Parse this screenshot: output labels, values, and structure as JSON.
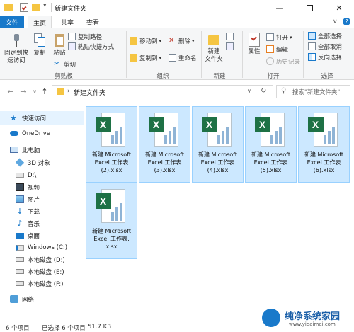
{
  "window": {
    "title": "新建文件夹"
  },
  "ribbon_tabs": [
    "文件",
    "主页",
    "共享",
    "查看"
  ],
  "ribbon": {
    "clipboard": {
      "pin_label_1": "固定到快",
      "pin_label_2": "速访问",
      "copy_label": "复制",
      "paste_label": "粘贴",
      "copy_path": "复制路径",
      "paste_shortcut": "粘贴快捷方式",
      "cut": "剪切",
      "group": "剪贴板"
    },
    "organize": {
      "move_to": "移动到",
      "delete": "删除",
      "copy_to": "复制到",
      "rename": "重命名",
      "group": "组织"
    },
    "new": {
      "new_folder_1": "新建",
      "new_folder_2": "文件夹",
      "group": "新建"
    },
    "open": {
      "properties": "属性",
      "open": "打开",
      "edit": "编辑",
      "history": "历史记录",
      "group": "打开"
    },
    "select": {
      "select_all": "全部选择",
      "select_none": "全部取消",
      "invert": "反向选择",
      "group": "选择"
    }
  },
  "address": {
    "path": "新建文件夹",
    "search_placeholder": "搜索\"新建文件夹\""
  },
  "nav": {
    "quick_access": "快速访问",
    "onedrive": "OneDrive",
    "this_pc": "此电脑",
    "objects3d": "3D 对象",
    "d_drive": "D:\\",
    "videos": "视频",
    "pictures": "图片",
    "downloads": "下载",
    "music": "音乐",
    "desktop": "桌面",
    "windows_c": "Windows (C:)",
    "disk_d": "本地磁盘 (D:)",
    "disk_e": "本地磁盘 (E:)",
    "disk_f": "本地磁盘 (F:)",
    "network": "网络"
  },
  "files": [
    {
      "l1": "新建 Microsoft",
      "l2": "Excel 工作表",
      "l3": "(2).xlsx"
    },
    {
      "l1": "新建 Microsoft",
      "l2": "Excel 工作表",
      "l3": "(3).xlsx"
    },
    {
      "l1": "新建 Microsoft",
      "l2": "Excel 工作表",
      "l3": "(4).xlsx"
    },
    {
      "l1": "新建 Microsoft",
      "l2": "Excel 工作表",
      "l3": "(5).xlsx"
    },
    {
      "l1": "新建 Microsoft",
      "l2": "Excel 工作表",
      "l3": "(6).xlsx"
    },
    {
      "l1": "新建 Microsoft",
      "l2": "Excel 工作表.",
      "l3": "xlsx"
    }
  ],
  "status": {
    "count": "6 个项目",
    "selected": "已选择 6 个项目",
    "size": "51.7 KB"
  },
  "watermark": {
    "text": "纯净系统家园",
    "url": "www.yidaimei.com"
  },
  "colors": {
    "accent": "#1979ca",
    "selection": "#cce8ff",
    "excel_green": "#1e7145"
  }
}
